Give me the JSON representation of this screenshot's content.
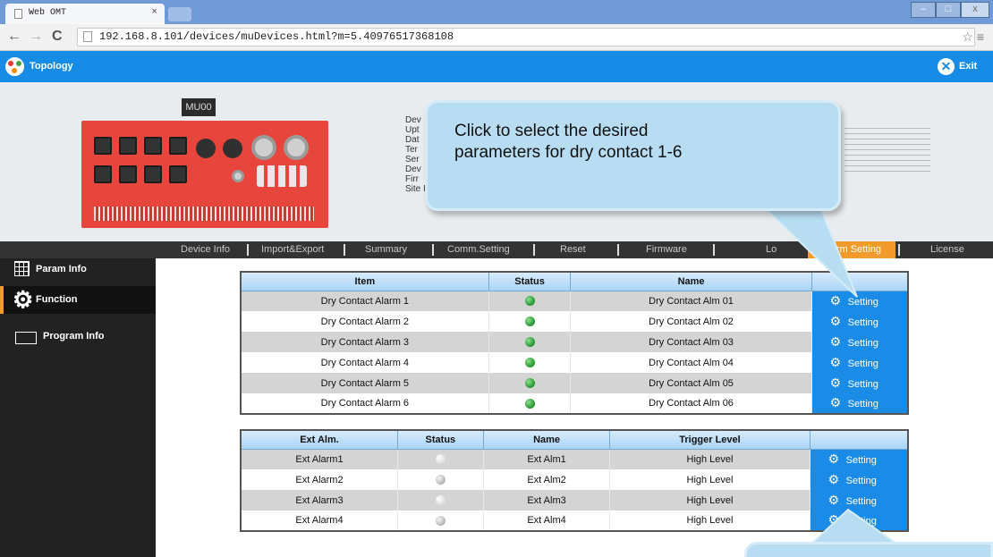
{
  "browser": {
    "tab_title": "Web OMT",
    "tab_close": "×",
    "url": "192.168.8.101/devices/muDevices.html?m=5.40976517368108",
    "win_min": "–",
    "win_max": "□",
    "win_close": "x"
  },
  "header": {
    "topology_label": "Topology",
    "exit_label": "Exit"
  },
  "device": {
    "tag": "MU00",
    "info_lines": [
      "Dev",
      "Upt",
      "Dat",
      "Ter",
      "Ser",
      "Dev",
      "Firr",
      "Site ID"
    ]
  },
  "tabs": [
    {
      "label": "Device Info"
    },
    {
      "label": "Import&Export"
    },
    {
      "label": "Summary"
    },
    {
      "label": "Comm.Setting"
    },
    {
      "label": "Reset"
    },
    {
      "label": "Firmware"
    },
    {
      "label": "Lo"
    },
    {
      "label": "Alarm Setting"
    },
    {
      "label": "License"
    }
  ],
  "sidebar": {
    "items": [
      {
        "label": "Param Info"
      },
      {
        "label": "Function"
      },
      {
        "label": "Program Info"
      }
    ]
  },
  "dry_contact_table": {
    "headers": {
      "item": "Item",
      "status": "Status",
      "name": "Name"
    },
    "setting_label": "Setting",
    "rows": [
      {
        "item": "Dry Contact Alarm 1",
        "name": "Dry Contact Alm 01",
        "status_color": "#2f9d3a"
      },
      {
        "item": "Dry Contact Alarm 2",
        "name": "Dry Contact Alm 02",
        "status_color": "#2f9d3a"
      },
      {
        "item": "Dry Contact Alarm 3",
        "name": "Dry Contact Alm 03",
        "status_color": "#2f9d3a"
      },
      {
        "item": "Dry Contact Alarm 4",
        "name": "Dry Contact Alm 04",
        "status_color": "#2f9d3a"
      },
      {
        "item": "Dry Contact Alarm 5",
        "name": "Dry Contact Alm 05",
        "status_color": "#2f9d3a"
      },
      {
        "item": "Dry Contact Alarm 6",
        "name": "Dry Contact Alm 06",
        "status_color": "#2f9d3a"
      }
    ]
  },
  "ext_alarm_table": {
    "headers": {
      "ext_alm": "Ext Alm.",
      "status": "Status",
      "name": "Name",
      "trigger": "Trigger Level"
    },
    "setting_label": "Setting",
    "rows": [
      {
        "ext": "Ext Alarm1",
        "name": "Ext Alm1",
        "trigger": "High Level",
        "status_color": "#dcdcdc"
      },
      {
        "ext": "Ext Alarm2",
        "name": "Ext Alm2",
        "trigger": "High Level",
        "status_color": "#bdbdbd"
      },
      {
        "ext": "Ext Alarm3",
        "name": "Ext Alm3",
        "trigger": "High Level",
        "status_color": "#dcdcdc"
      },
      {
        "ext": "Ext Alarm4",
        "name": "Ext Alm4",
        "trigger": "High Level",
        "status_color": "#bdbdbd"
      }
    ]
  },
  "callout": {
    "line1": "Click to select the desired",
    "line2": "parameters for dry contact 1-6"
  },
  "colors": {
    "header_blue": "#168ce6",
    "active_tab_orange": "#f29b2c",
    "setting_blue": "#1b8be8"
  }
}
